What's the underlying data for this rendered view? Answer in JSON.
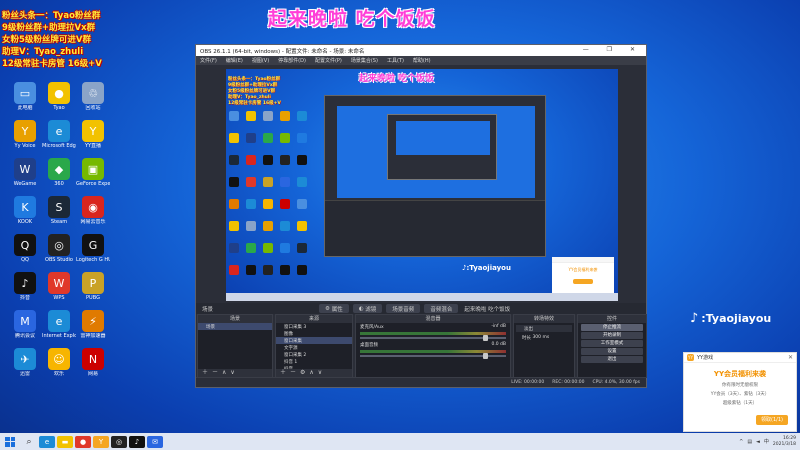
{
  "stream_title": "起来晚啦 吃个饭饭",
  "promo_lines": [
    "粉丝头条一：Tyao粉丝群",
    "9级粉丝群+助理拉Vx群",
    "女粉5级粉丝牌可进V群",
    "助理V：Tyao_zhuli",
    "12级常驻卡房管 16级+V"
  ],
  "brand_handle": ":Tyaojiayou",
  "desktop_icons": [
    {
      "label": "此电脑",
      "color": "#4a8fe0",
      "glyph": "▭"
    },
    {
      "label": "Tyao",
      "color": "#f2c200",
      "glyph": "●"
    },
    {
      "label": "回收站",
      "color": "#8aa4c8",
      "glyph": "♲"
    },
    {
      "label": "Yy Voice",
      "color": "#e8a000",
      "glyph": "Y"
    },
    {
      "label": "Microsoft Edge",
      "color": "#1c8bd6",
      "glyph": "e"
    },
    {
      "label": "YY直播",
      "color": "#f2c200",
      "glyph": "Y"
    },
    {
      "label": "WeGame",
      "color": "#1f3f8a",
      "glyph": "W"
    },
    {
      "label": "360",
      "color": "#2aa84a",
      "glyph": "◆"
    },
    {
      "label": "GeForce Experience",
      "color": "#76b900",
      "glyph": "▣"
    },
    {
      "label": "KOOK",
      "color": "#1f7ae0",
      "glyph": "K"
    },
    {
      "label": "Steam",
      "color": "#1b2838",
      "glyph": "S"
    },
    {
      "label": "网易云音乐",
      "color": "#d9251d",
      "glyph": "◉"
    },
    {
      "label": "QQ",
      "color": "#111",
      "glyph": "Q"
    },
    {
      "label": "OBS Studio",
      "color": "#222",
      "glyph": "◎"
    },
    {
      "label": "Logitech G HUB",
      "color": "#111",
      "glyph": "G"
    },
    {
      "label": "抖音",
      "color": "#111",
      "glyph": "♪"
    },
    {
      "label": "WPS",
      "color": "#e0382a",
      "glyph": "W"
    },
    {
      "label": "PUBG",
      "color": "#c9a227",
      "glyph": "P"
    },
    {
      "label": "腾讯会议",
      "color": "#2a66e0",
      "glyph": "M"
    },
    {
      "label": "Internet Explorer",
      "color": "#1c8bd6",
      "glyph": "e"
    },
    {
      "label": "雷神加速器",
      "color": "#e07a00",
      "glyph": "⚡"
    },
    {
      "label": "迅雷",
      "color": "#1c8bd6",
      "glyph": "✈"
    },
    {
      "label": "欢乐",
      "color": "#f7b500",
      "glyph": "☺"
    },
    {
      "label": "网易",
      "color": "#c00",
      "glyph": "N"
    }
  ],
  "obs": {
    "title": "OBS 26.1.1 (64-bit, windows) - 配置文件: 未命名 - 场景: 未命名",
    "menu": [
      "文件(F)",
      "编辑(E)",
      "视图(V)",
      "停靠部件(D)",
      "配置文件(P)",
      "场景集合(S)",
      "工具(T)",
      "帮助(H)"
    ],
    "window_controls": "— ❐ ✕",
    "dock_titles": [
      "场景",
      "属性",
      "滤镜",
      "场景音频",
      "音频混合",
      "起来晚啦 吃个饭饭"
    ],
    "scenes_header": "场景",
    "scenes": [
      "场景"
    ],
    "sources_header": "来源",
    "sources": [
      "窗口采集 3",
      "图像",
      "窗口采集",
      "文字源",
      "窗口采集 2",
      "抖音 1",
      "抖音"
    ],
    "mixer_header": "混音器",
    "mixer": [
      {
        "name": "麦克风/Aux",
        "db": "-inf dB"
      },
      {
        "name": "桌面音频",
        "db": "0.0 dB"
      }
    ],
    "transitions_header": "转场特效",
    "transition_value": "淡出",
    "duration_label": "时长",
    "duration_value": "300 ms",
    "controls_header": "控件",
    "controls": [
      "停止推流",
      "开始录制",
      "工作室模式",
      "设置",
      "退出"
    ],
    "status": {
      "live": "LIVE: 00:00:00",
      "rec": "REC: 00:00:00",
      "cpu": "CPU: 4.0%, 30.00 fps"
    }
  },
  "yy_popup": {
    "app_name": "YY游戏",
    "title": "YY会员福利来袭",
    "lines": [
      "你有限时无偿权限",
      "YY会员（3天）、紫钻（3天）",
      "超级紫钻（1天）"
    ],
    "button": "领取(1/1)"
  },
  "taskbar": {
    "tray_text": "中",
    "time": "16:29",
    "date": "2021/3/18"
  }
}
